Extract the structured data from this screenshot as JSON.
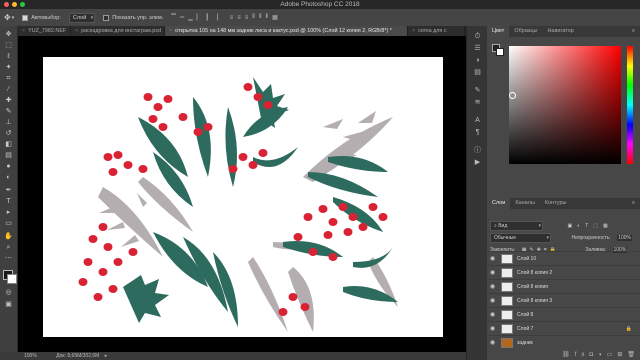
{
  "app": {
    "title": "Adobe Photoshop CC 2018"
  },
  "options_bar": {
    "auto_select_label": "Автовыбор:",
    "auto_select_value": "Слой",
    "show_controls_label": "Показать упр. элем."
  },
  "tabs": [
    {
      "label": "YUZ_7982.NEF"
    },
    {
      "label": "раскадровка для инстаграм.psd"
    },
    {
      "label": "открытка 105 на 148 мм задник лиса и кактус.psd @ 100% (Слой 12 копия 2, RGB/8*) *"
    },
    {
      "label": "сетка для с"
    }
  ],
  "status_bar": {
    "zoom": "100%",
    "doc_info": "Док: 8,65M/302,6M"
  },
  "color_panel": {
    "tabs": [
      "Цвет",
      "Образцы",
      "Навигатор"
    ],
    "hue_color": "#ff0000"
  },
  "layers_panel": {
    "tabs": [
      "Слои",
      "Каналы",
      "Контуры"
    ],
    "filter_label": "Вид",
    "blend_mode": "Обычные",
    "opacity_label": "Непрозрачность:",
    "opacity_value": "100%",
    "lock_label": "Закрепить:",
    "fill_label": "Заливка:",
    "fill_value": "100%",
    "layers": [
      {
        "name": "Слой 10"
      },
      {
        "name": "Слой 8 копия 2"
      },
      {
        "name": "Слой 8 копия"
      },
      {
        "name": "Слой 8 копия 3"
      },
      {
        "name": "Слой 8"
      },
      {
        "name": "Слой 7"
      },
      {
        "name": "задник"
      }
    ]
  },
  "artwork": {
    "leaf_color": "#2e6b5f",
    "berry_color": "#d92335",
    "branch_color": "#b5aeb0"
  }
}
